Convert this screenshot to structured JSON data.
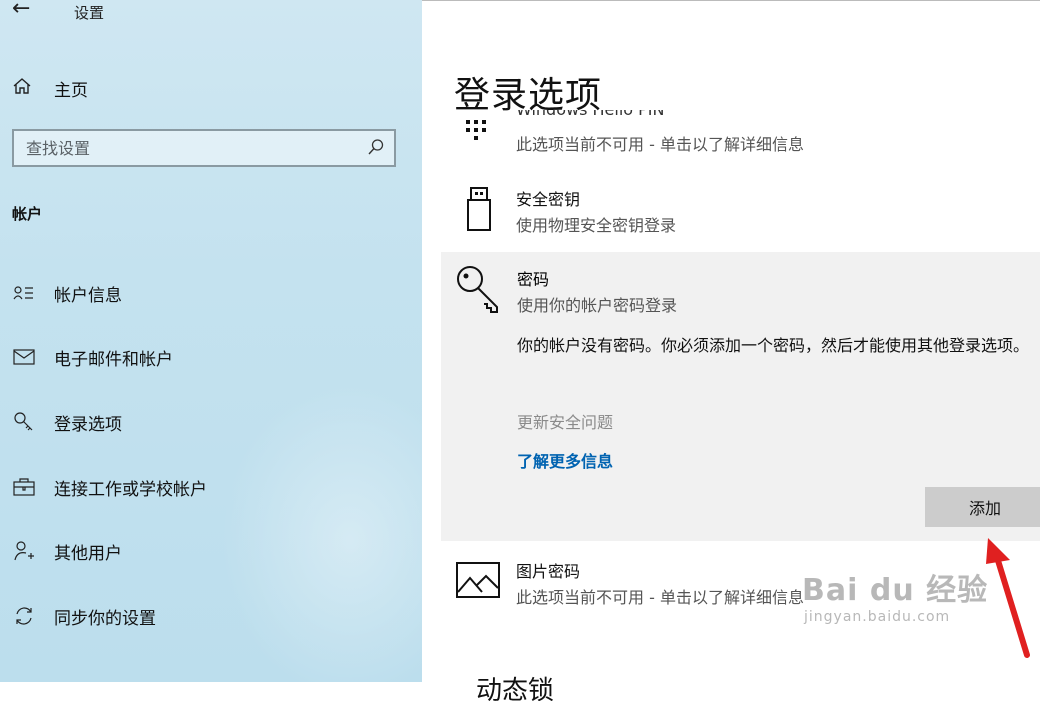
{
  "window": {
    "title": "设置",
    "back_icon": "back-arrow-icon"
  },
  "sidebar": {
    "home_label": "主页",
    "search": {
      "placeholder": "查找设置",
      "value": ""
    },
    "section_title": "帐户",
    "items": [
      {
        "label": "帐户信息",
        "icon": "person-card-icon"
      },
      {
        "label": "电子邮件和帐户",
        "icon": "mail-icon"
      },
      {
        "label": "登录选项",
        "icon": "key-icon"
      },
      {
        "label": "连接工作或学校帐户",
        "icon": "briefcase-icon"
      },
      {
        "label": "其他用户",
        "icon": "add-person-icon"
      },
      {
        "label": "同步你的设置",
        "icon": "sync-icon"
      }
    ]
  },
  "main": {
    "title": "登录选项",
    "options": [
      {
        "title": "Windows Hello PIN",
        "desc": "此选项当前不可用 - 单击以了解详细信息",
        "icon": "keypad-icon"
      },
      {
        "title": "安全密钥",
        "desc": "使用物理安全密钥登录",
        "icon": "usb-key-icon"
      },
      {
        "title": "密码",
        "desc": "使用你的帐户密码登录",
        "icon": "key-icon"
      },
      {
        "title": "图片密码",
        "desc": "此选项当前不可用 - 单击以了解详细信息",
        "icon": "picture-icon"
      }
    ],
    "password_panel": {
      "message": "你的帐户没有密码。你必须添加一个密码，然后才能使用其他登录选项。",
      "security_questions_link": "更新安全问题",
      "learn_more_link": "了解更多信息",
      "add_button": "添加"
    },
    "bottom_partial": "动态锁"
  },
  "watermark": {
    "line1": "Bai du 经验",
    "line2": "jingyan.baidu.com"
  },
  "colors": {
    "sidebar_bg": "#c4e2ef",
    "link": "#0063b1",
    "panel_bg": "#f1f1f1",
    "button_bg": "#cccccc",
    "arrow": "#e02020"
  }
}
